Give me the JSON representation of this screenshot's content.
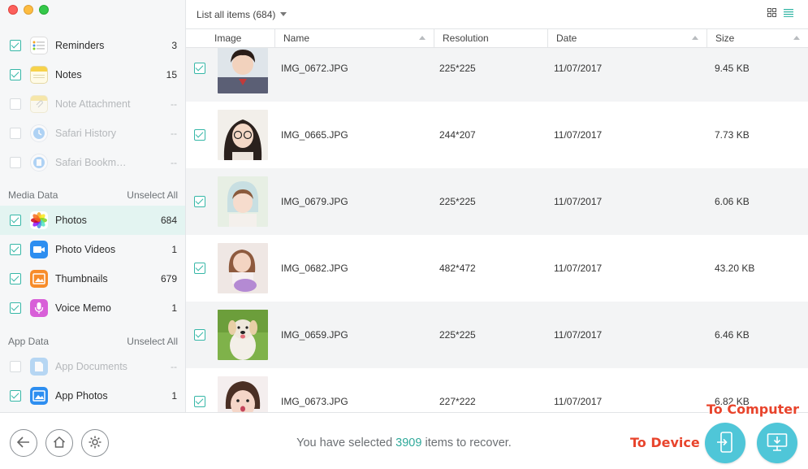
{
  "sidebar": {
    "items": [
      {
        "label": "Reminders",
        "count": "3",
        "checked": true,
        "enabled": true,
        "icon": "reminders-icon"
      },
      {
        "label": "Notes",
        "count": "15",
        "checked": true,
        "enabled": true,
        "icon": "notes-icon"
      },
      {
        "label": "Note Attachment",
        "count": "--",
        "checked": false,
        "enabled": false,
        "icon": "note-attachment-icon"
      },
      {
        "label": "Safari History",
        "count": "--",
        "checked": false,
        "enabled": false,
        "icon": "safari-history-icon"
      },
      {
        "label": "Safari Bookm…",
        "count": "--",
        "checked": false,
        "enabled": false,
        "icon": "safari-bookmark-icon"
      }
    ],
    "media_section": {
      "title": "Media Data",
      "action": "Unselect All"
    },
    "media_items": [
      {
        "label": "Photos",
        "count": "684",
        "checked": true,
        "enabled": true,
        "icon": "photos-icon"
      },
      {
        "label": "Photo Videos",
        "count": "1",
        "checked": true,
        "enabled": true,
        "icon": "photo-videos-icon"
      },
      {
        "label": "Thumbnails",
        "count": "679",
        "checked": true,
        "enabled": true,
        "icon": "thumbnails-icon"
      },
      {
        "label": "Voice Memo",
        "count": "1",
        "checked": true,
        "enabled": true,
        "icon": "voice-memo-icon"
      }
    ],
    "app_section": {
      "title": "App Data",
      "action": "Unselect All"
    },
    "app_items": [
      {
        "label": "App Documents",
        "count": "--",
        "checked": false,
        "enabled": false,
        "icon": "app-documents-icon"
      },
      {
        "label": "App Photos",
        "count": "1",
        "checked": true,
        "enabled": true,
        "icon": "app-photos-icon"
      }
    ]
  },
  "toolbar": {
    "list_label": "List all items (684)",
    "grid_icon": "grid-view-icon",
    "list_icon": "list-view-icon"
  },
  "table": {
    "columns": [
      "Image",
      "Name",
      "Resolution",
      "Date",
      "Size"
    ],
    "rows": [
      {
        "name": "IMG_0672.JPG",
        "resolution": "225*225",
        "date": "11/07/2017",
        "size": "9.45 KB"
      },
      {
        "name": "IMG_0665.JPG",
        "resolution": "244*207",
        "date": "11/07/2017",
        "size": "7.73 KB"
      },
      {
        "name": "IMG_0679.JPG",
        "resolution": "225*225",
        "date": "11/07/2017",
        "size": "6.06 KB"
      },
      {
        "name": "IMG_0682.JPG",
        "resolution": "482*472",
        "date": "11/07/2017",
        "size": "43.20 KB"
      },
      {
        "name": "IMG_0659.JPG",
        "resolution": "225*225",
        "date": "11/07/2017",
        "size": "6.46 KB"
      },
      {
        "name": "IMG_0673.JPG",
        "resolution": "227*222",
        "date": "11/07/2017",
        "size": "6.82 KB"
      }
    ]
  },
  "footer": {
    "status_prefix": "You have selected",
    "status_count": "3909",
    "status_suffix": "items to recover.",
    "to_device": "To Device",
    "to_computer": "To Computer"
  },
  "colors": {
    "accent": "#36b7a7",
    "action_button": "#4fc6d8",
    "callout": "#e8442c"
  }
}
